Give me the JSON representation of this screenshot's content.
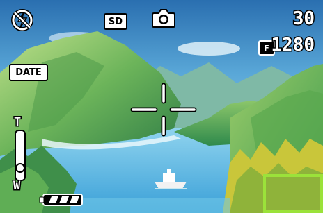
{
  "camera": {
    "shots_remaining": "30",
    "image_size": "1280",
    "image_quality_icon_label": "F",
    "storage_label": "SD",
    "date_label": "DATE",
    "zoom_tele_label": "T",
    "zoom_wide_label": "W",
    "zoom_level": 0.15,
    "battery_level": 1.0
  },
  "icons": {
    "flash": "flash-off-icon",
    "mode": "camera-still-icon",
    "focus": "focus-crosshair-icon",
    "battery": "battery-icon",
    "quality": "image-quality-icon"
  },
  "colors": {
    "osd": "#ffffff",
    "af_frame": "#9be23a"
  }
}
